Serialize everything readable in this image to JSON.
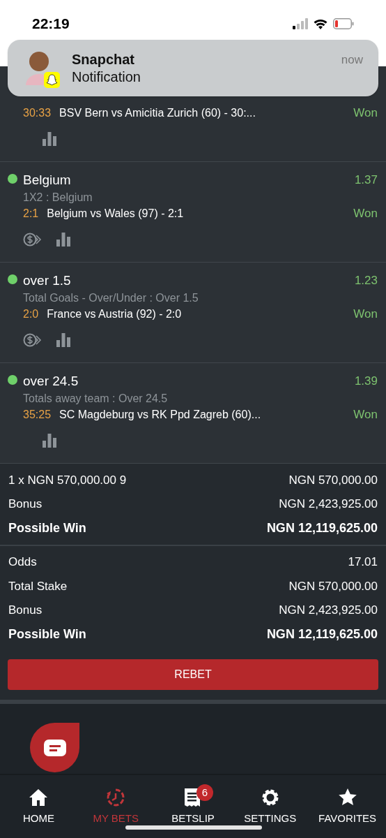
{
  "status_bar": {
    "time": "22:19"
  },
  "notification": {
    "app": "Snapchat",
    "message": "Notification",
    "time": "now"
  },
  "bets": [
    {
      "score": "30:33",
      "match": "BSV Bern vs Amicitia Zurich (60) - 30:...",
      "result": "Won",
      "cashout": false
    },
    {
      "name": "Belgium",
      "odds": "1.37",
      "market": "1X2 : Belgium",
      "score": "2:1",
      "match": "Belgium vs Wales (97) - 2:1",
      "result": "Won",
      "cashout": true
    },
    {
      "name": "over 1.5",
      "odds": "1.23",
      "market": "Total Goals - Over/Under : Over 1.5",
      "score": "2:0",
      "match": "France vs Austria (92) - 2:0",
      "result": "Won",
      "cashout": true
    },
    {
      "name": "over 24.5",
      "odds": "1.39",
      "market": "Totals away team : Over 24.5",
      "score": "35:25",
      "match": "SC Magdeburg vs RK Ppd Zagreb (60)...",
      "result": "Won",
      "cashout": false
    }
  ],
  "system_summary": [
    {
      "label": "1 x NGN 570,000.00 9",
      "value": "NGN 570,000.00",
      "bold": false
    },
    {
      "label": "Bonus",
      "value": "NGN 2,423,925.00",
      "bold": false
    },
    {
      "label": "Possible Win",
      "value": "NGN 12,119,625.00",
      "bold": true
    }
  ],
  "totals": [
    {
      "label": "Odds",
      "value": "17.01",
      "bold": false
    },
    {
      "label": "Total Stake",
      "value": "NGN 570,000.00",
      "bold": false
    },
    {
      "label": "Bonus",
      "value": "NGN 2,423,925.00",
      "bold": false
    },
    {
      "label": "Possible Win",
      "value": "NGN 12,119,625.00",
      "bold": true
    }
  ],
  "rebet_button": "REBET",
  "nav": [
    {
      "kind": "home",
      "label": "HOME",
      "selected": false
    },
    {
      "kind": "mybets",
      "label": "MY BETS",
      "selected": true
    },
    {
      "kind": "betslip",
      "label": "BETSLIP",
      "selected": false,
      "badge": "6"
    },
    {
      "kind": "settings",
      "label": "SETTINGS",
      "selected": false
    },
    {
      "kind": "favorites",
      "label": "FAVORITES",
      "selected": false
    }
  ]
}
